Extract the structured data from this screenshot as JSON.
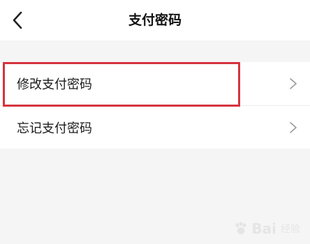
{
  "header": {
    "title": "支付密码",
    "back_icon": "chevron-left-icon"
  },
  "menu": {
    "items": [
      {
        "label": "修改支付密码",
        "icon": "chevron-right-icon",
        "highlighted": true
      },
      {
        "label": "忘记支付密码",
        "icon": "chevron-right-icon",
        "highlighted": false
      }
    ]
  },
  "highlight": {
    "color": "#d6343e"
  },
  "watermark": {
    "brand": "Bai",
    "suffix": "经验"
  }
}
